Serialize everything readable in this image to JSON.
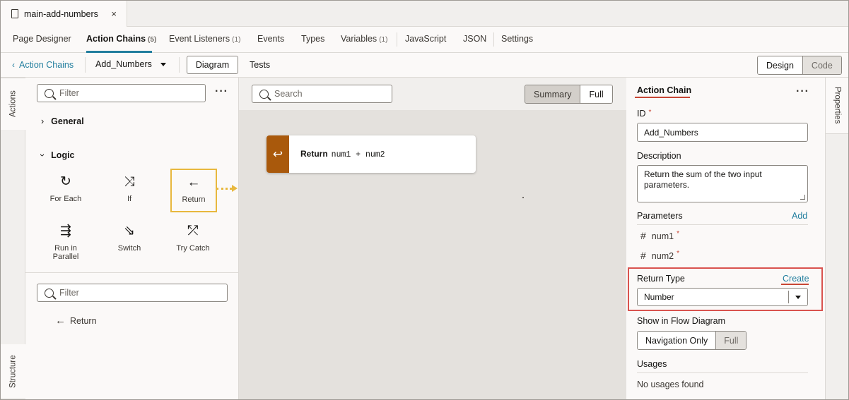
{
  "file_tab": {
    "title": "main-add-numbers",
    "close_icon": "×"
  },
  "main_tabs": [
    {
      "label": "Page Designer",
      "count": ""
    },
    {
      "label": "Action Chains",
      "count": "(5)"
    },
    {
      "label": "Event Listeners",
      "count": "(1)"
    },
    {
      "label": "Events",
      "count": ""
    },
    {
      "label": "Types",
      "count": ""
    },
    {
      "label": "Variables",
      "count": "(1)"
    },
    {
      "label": "JavaScript",
      "count": ""
    },
    {
      "label": "JSON",
      "count": ""
    },
    {
      "label": "Settings",
      "count": ""
    }
  ],
  "toolbar": {
    "back_label": "Action Chains",
    "chain_name": "Add_Numbers",
    "diagram_label": "Diagram",
    "tests_label": "Tests",
    "design_label": "Design",
    "code_label": "Code"
  },
  "left_rail": {
    "actions_label": "Actions",
    "structure_label": "Structure"
  },
  "palette": {
    "filter_placeholder": "Filter",
    "kebab": "···",
    "groups": {
      "general": "General",
      "logic": "Logic"
    },
    "items": {
      "for_each": {
        "label": "For Each",
        "icon": "for-each-icon"
      },
      "if": {
        "label": "If",
        "icon": "if-branch-icon"
      },
      "return": {
        "label": "Return",
        "icon": "return-arrow-icon"
      },
      "run_in_parallel": {
        "label": "Run in Parallel",
        "icon": "parallel-icon"
      },
      "switch": {
        "label": "Switch",
        "icon": "switch-icon"
      },
      "try_catch": {
        "label": "Try Catch",
        "icon": "try-catch-icon"
      }
    },
    "structure_filter_placeholder": "Filter",
    "structure_item": "Return"
  },
  "canvas": {
    "search_placeholder": "Search",
    "summary_label": "Summary",
    "full_label": "Full",
    "node": {
      "title": "Return",
      "expression": "num1 + num2",
      "color": "#a9590c"
    }
  },
  "properties": {
    "heading": "Action Chain",
    "kebab": "···",
    "id_label": "ID",
    "required_mark": "*",
    "id_value": "Add_Numbers",
    "description_label": "Description",
    "description_value": "Return the sum of the two input parameters.",
    "parameters_label": "Parameters",
    "add_label": "Add",
    "parameters": [
      {
        "name": "num1"
      },
      {
        "name": "num2"
      }
    ],
    "return_type_label": "Return Type",
    "create_label": "Create",
    "return_type_value": "Number",
    "show_in_flow_label": "Show in Flow Diagram",
    "navigation_only_label": "Navigation Only",
    "full_label": "Full",
    "usages_label": "Usages",
    "usages_value": "No usages found"
  },
  "right_rail": {
    "properties_label": "Properties"
  },
  "colors": {
    "accent": "#227e9e",
    "highlight": "#e8b83e",
    "annotation": "#d9534f",
    "node_bar": "#a9590c"
  }
}
